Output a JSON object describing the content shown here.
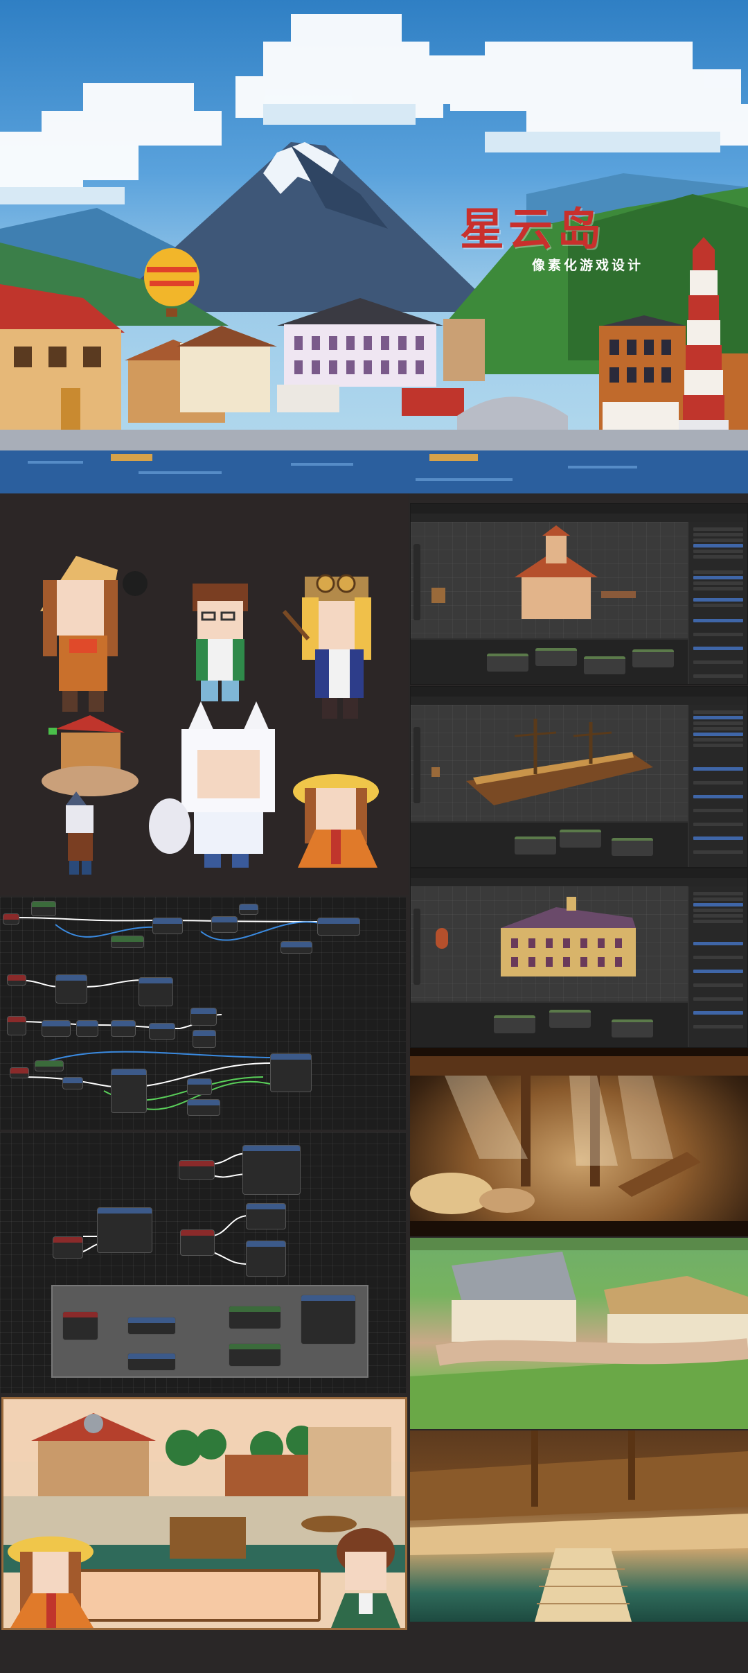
{
  "hero": {
    "title": "星云岛",
    "subtitle": "像素化游戏设计"
  },
  "colors": {
    "title_red": "#c9302c",
    "page_background": "#2a2727",
    "blueprint_background": "#1d1d1d",
    "blender_background": "#303030"
  },
  "panels": [
    "pixel-art-hero-banner",
    "pixel-character-sprites",
    "blender-tavern-model",
    "blender-pirate-ship-model",
    "blender-manor-model",
    "blueprint-node-graph-top",
    "blueprint-node-graph-bottom",
    "cellar-render",
    "village-render",
    "harbor-ship-render",
    "in-game-dialogue-scene"
  ]
}
